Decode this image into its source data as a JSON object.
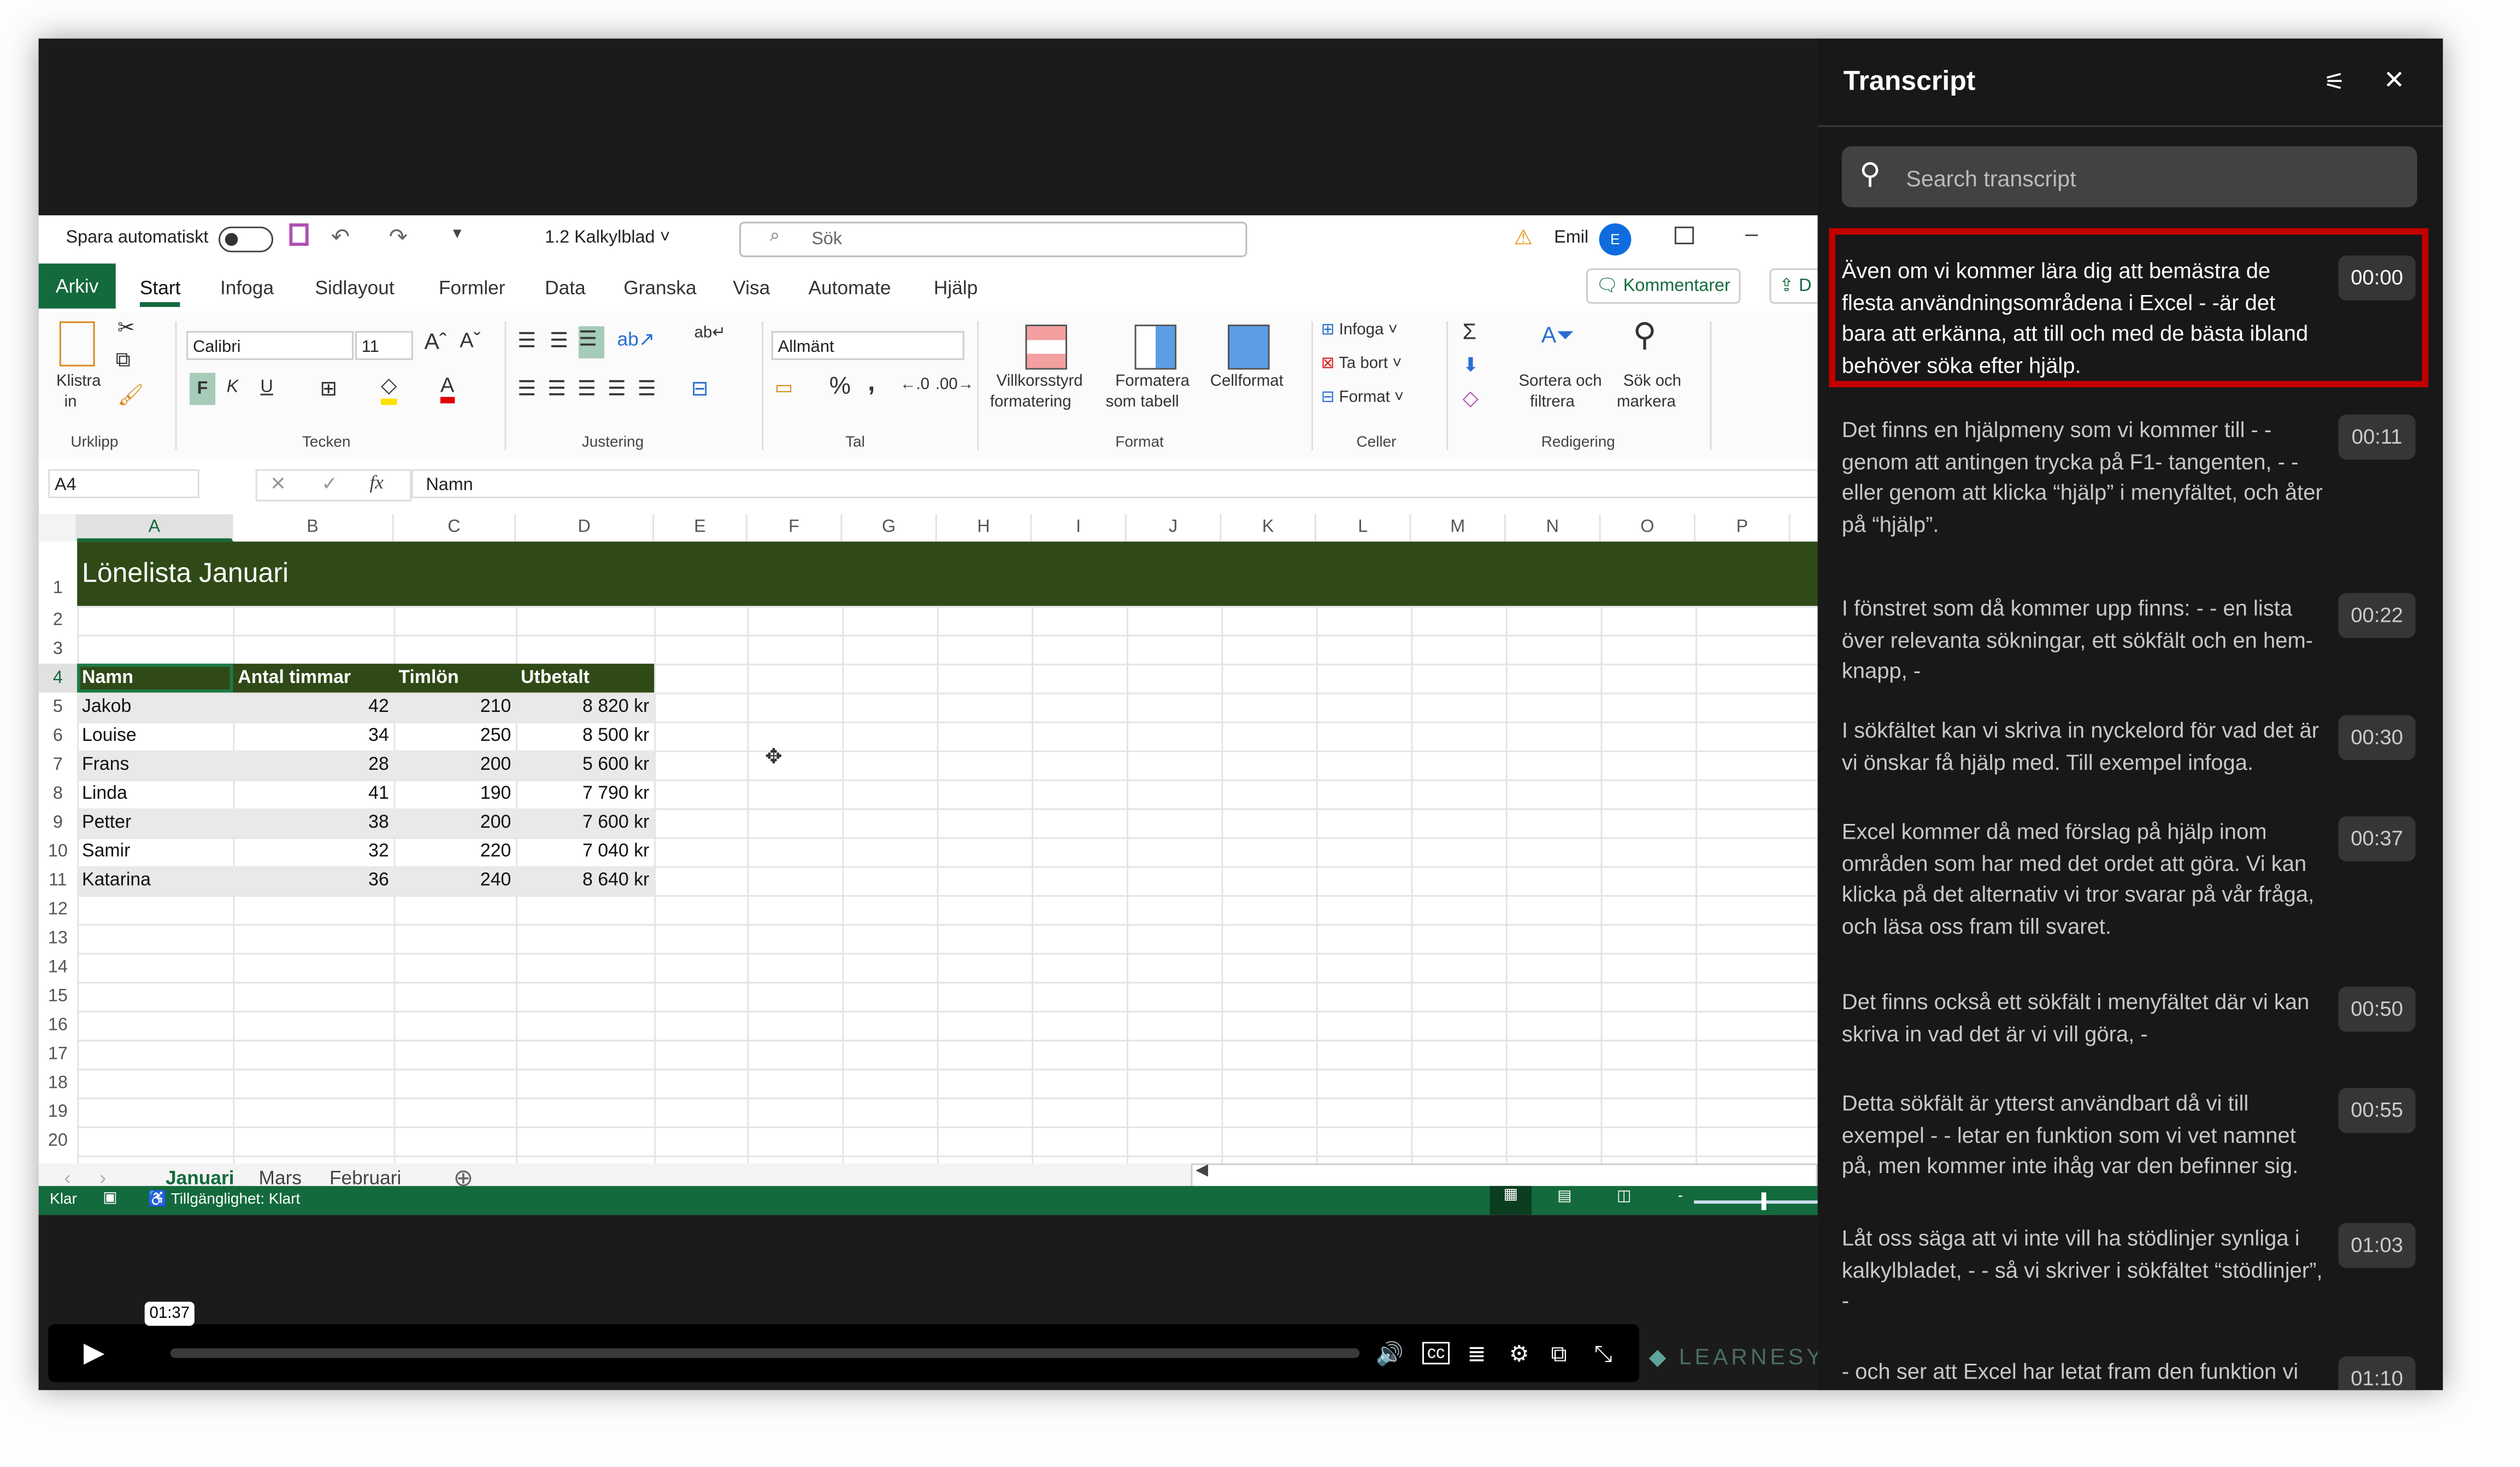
{
  "excel": {
    "titlebar": {
      "autosave_label": "Spara automatiskt",
      "filename": "1.2 Kalkylblad",
      "search_placeholder": "Sök",
      "user_name": "Emil",
      "avatar_initial": "E"
    },
    "tabs": [
      "Arkiv",
      "Start",
      "Infoga",
      "Sidlayout",
      "Formler",
      "Data",
      "Granska",
      "Visa",
      "Automate",
      "Hjälp"
    ],
    "active_tab": "Start",
    "comments_button": "Kommentarer",
    "share_button_partial": "D",
    "ribbon": {
      "groups": {
        "urklipp": "Urklipp",
        "tecken": "Tecken",
        "justering": "Justering",
        "tal": "Tal",
        "format": "Format",
        "celler": "Celler",
        "redigering": "Redigering"
      },
      "paste_label_1": "Klistra",
      "paste_label_2": "in",
      "font_name": "Calibri",
      "font_size": "11",
      "bold": "F",
      "italic": "K",
      "underline": "U",
      "number_format": "Allmänt",
      "conditional_1": "Villkorsstyrd",
      "conditional_2": "formatering",
      "as_table_1": "Formatera",
      "as_table_2": "som tabell",
      "cell_styles": "Cellformat",
      "insert": "Infoga",
      "delete": "Ta bort",
      "format": "Format",
      "sort_1": "Sortera och",
      "sort_2": "filtrera",
      "find_1": "Sök och",
      "find_2": "markera"
    },
    "formula_bar": {
      "name_box": "A4",
      "formula": "Namn"
    },
    "columns": [
      "A",
      "B",
      "C",
      "D",
      "E",
      "F",
      "G",
      "H",
      "I",
      "J",
      "K",
      "L",
      "M",
      "N",
      "O",
      "P"
    ],
    "rows": [
      "1",
      "2",
      "3",
      "4",
      "5",
      "6",
      "7",
      "8",
      "9",
      "10",
      "11",
      "12",
      "13",
      "14",
      "15",
      "16",
      "17",
      "18",
      "19",
      "20"
    ],
    "sheet_title": "Lönelista Januari",
    "table": {
      "headers": [
        "Namn",
        "Antal timmar",
        "Timlön",
        "Utbetalt"
      ],
      "rows": [
        [
          "Jakob",
          "42",
          "210",
          "8 820 kr"
        ],
        [
          "Louise",
          "34",
          "250",
          "8 500 kr"
        ],
        [
          "Frans",
          "28",
          "200",
          "5 600 kr"
        ],
        [
          "Linda",
          "41",
          "190",
          "7 790 kr"
        ],
        [
          "Petter",
          "38",
          "200",
          "7 600 kr"
        ],
        [
          "Samir",
          "32",
          "220",
          "7 040 kr"
        ],
        [
          "Katarina",
          "36",
          "240",
          "8 640 kr"
        ]
      ]
    },
    "sheets": [
      "Januari",
      "Mars",
      "Februari"
    ],
    "active_sheet": "Januari",
    "status": {
      "ready": "Klar",
      "accessibility": "Tillgänglighet: Klart"
    },
    "colors": {
      "excel_green": "#136a3c",
      "header_fill": "#2f4a17",
      "stripe": "#e9e9e9"
    }
  },
  "player": {
    "time_tooltip": "01:37",
    "progress": 0.0,
    "logo": "LEARNESY"
  },
  "transcript": {
    "title": "Transcript",
    "search_placeholder": "Search transcript",
    "highlight_color": "#c20000",
    "segments": [
      {
        "time": "00:00",
        "text": "Även om vi kommer lära dig att bemästra de flesta användningsområdena i Excel - -är det bara att erkänna, att till och med de bästa ibland behöver söka efter hjälp.",
        "active": true
      },
      {
        "time": "00:11",
        "text": "Det finns en hjälpmeny som vi kommer till - - genom att antingen trycka på F1- tangenten, - - eller genom att klicka “hjälp” i menyfältet, och åter på “hjälp”.",
        "active": false
      },
      {
        "time": "00:22",
        "text": "I fönstret som då kommer upp finns: - - en lista över relevanta sökningar, ett sökfält och en hem-knapp, -",
        "active": false
      },
      {
        "time": "00:30",
        "text": "I sökfältet kan vi skriva in nyckelord för vad det är vi önskar få hjälp med. Till exempel infoga.",
        "active": false
      },
      {
        "time": "00:37",
        "text": "Excel kommer då med förslag på hjälp inom områden som har med det ordet att göra. Vi kan klicka på det alternativ vi tror svarar på vår fråga, och läsa oss fram till svaret.",
        "active": false
      },
      {
        "time": "00:50",
        "text": "Det finns också ett sökfält i menyfältet där vi kan skriva in vad det är vi vill göra, -",
        "active": false
      },
      {
        "time": "00:55",
        "text": "Detta sökfält är ytterst användbart då vi till exempel - - letar en funktion som vi vet namnet på, men kommer inte ihåg var den befinner sig.",
        "active": false
      },
      {
        "time": "01:03",
        "text": "Låt oss säga att vi inte vill ha stödlinjer synliga i kalkylbladet, - - så vi skriver i sökfältet “stödlinjer”, -",
        "active": false
      },
      {
        "time": "01:10",
        "text": "- och ser att Excel har letat fram den funktion vi",
        "active": false
      }
    ]
  }
}
